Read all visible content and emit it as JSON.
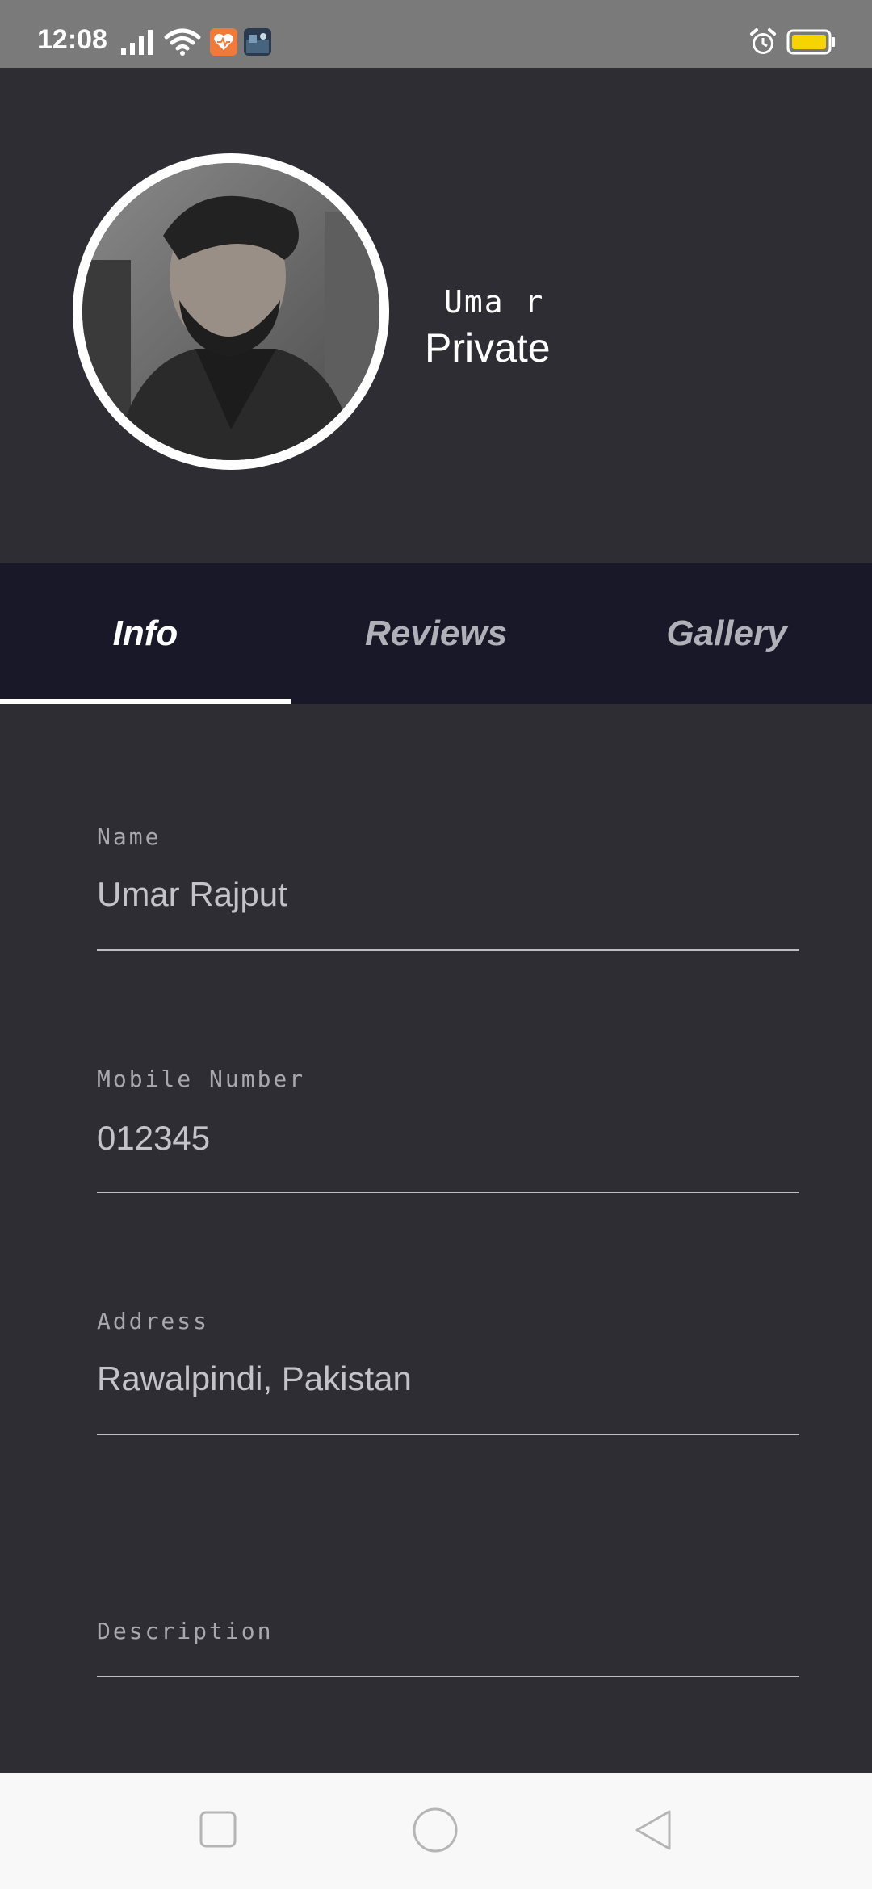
{
  "status_bar": {
    "time": "12:08",
    "icons": [
      "signal-icon",
      "wifi-icon",
      "health-app-icon",
      "photo-app-icon",
      "alarm-icon",
      "battery-icon"
    ],
    "colors": {
      "background": "#7a7a7a",
      "battery_fill": "#f5d400",
      "health_app": "#f07a3a"
    }
  },
  "profile": {
    "username": "Uma r",
    "account_type": "Private",
    "avatar_icon": "profile-photo"
  },
  "tabs": [
    {
      "label": "Info",
      "active": true
    },
    {
      "label": "Reviews",
      "active": false
    },
    {
      "label": "Gallery",
      "active": false
    }
  ],
  "form": {
    "name": {
      "label": "Name",
      "value": "Umar Rajput"
    },
    "mobile": {
      "label": "Mobile Number",
      "value": "012345"
    },
    "address": {
      "label": "Address",
      "value": "Rawalpindi, Pakistan"
    },
    "description": {
      "label": "Description",
      "value": ""
    }
  },
  "nav_bar": {
    "buttons": [
      "recent-apps-icon",
      "home-icon",
      "back-icon"
    ]
  },
  "colors": {
    "background": "#2e2d33",
    "tab_bar": "#191829",
    "accent": "#ffffff"
  }
}
